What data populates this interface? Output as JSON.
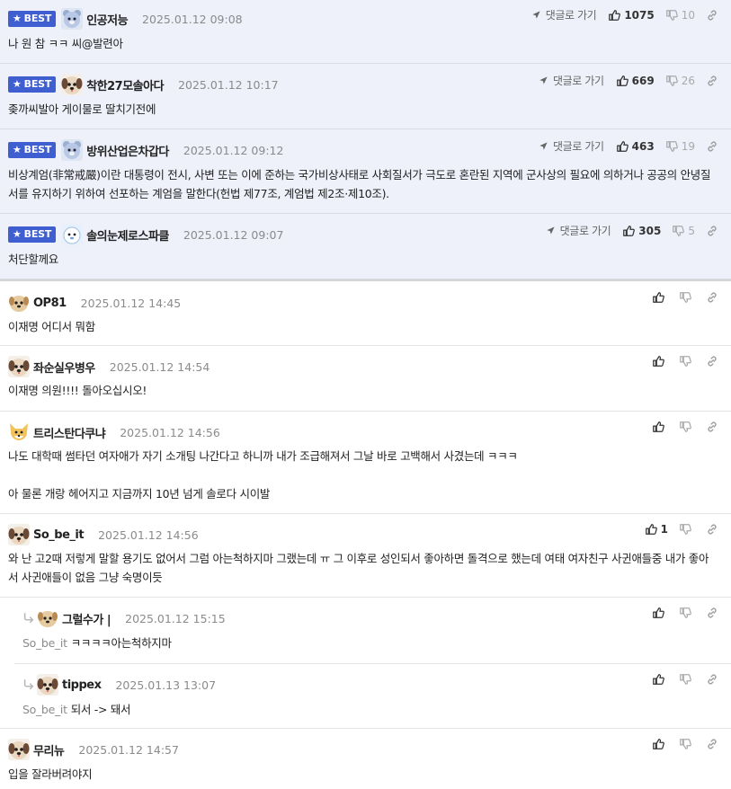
{
  "colors": {
    "best_bg": "#eef0fa",
    "badge": "#3f5fd0"
  },
  "best_badge": "BEST",
  "reply_label": "댓글로 가기",
  "best_comments": [
    {
      "nick": "인공저능",
      "time": "2025.01.12 09:08",
      "text": "나 원 참 ㅋㅋ 씨@발련아",
      "up": "1075",
      "down": "10"
    },
    {
      "nick": "착한27모솔아다",
      "time": "2025.01.12 10:17",
      "text": "좆까씨발아 게이물로 딸치기전에",
      "up": "669",
      "down": "26"
    },
    {
      "nick": "방위산업은차갑다",
      "time": "2025.01.12 09:12",
      "text": "비상계엄(非常戒嚴)이란 대통령이 전시, 사변 또는 이에 준하는 국가비상사태로 사회질서가 극도로 혼란된 지역에 군사상의 필요에 의하거나 공공의 안녕질서를 유지하기 위하여 선포하는 계엄을 말한다(헌법 제77조, 계엄법 제2조·제10조).",
      "up": "463",
      "down": "19"
    },
    {
      "nick": "솔의눈제로스파클",
      "time": "2025.01.12 09:07",
      "text": "처단할께요",
      "up": "305",
      "down": "5"
    }
  ],
  "comments": [
    {
      "nick": "OP81",
      "time": "2025.01.12 14:45",
      "text": "이재명 어디서 뭐함"
    },
    {
      "nick": "좌순실우병우",
      "time": "2025.01.12 14:54",
      "text": "이재명 의원!!!! 돌아오십시오!"
    },
    {
      "nick": "트리스탄다쿠냐",
      "time": "2025.01.12 14:56",
      "text1": "나도 대학때 썸타던 여자애가 자기 소개팅 나간다고 하니까 내가 조급해져서 그날 바로 고백해서 사겼는데 ㅋㅋㅋ",
      "text2": "아 물론 개랑 헤어지고 지금까지 10년 넘게 솔로다 시이발"
    },
    {
      "nick": "So_be_it",
      "time": "2025.01.12 14:56",
      "text": "와 난 고2때 저렇게 말할 용기도 없어서 그럼 아는척하지마 그랬는데 ㅠ 그 이후로 성인되서 좋아하면 돌격으로 했는데 여태 여자친구 사귄애들중 내가 좋아서 사귄애들이 없음 그냥 숙명이듯",
      "up": "1"
    },
    {
      "nick": "그럴수가 |",
      "time": "2025.01.12 15:15",
      "mention": "So_be_it",
      "text": "ㅋㅋㅋㅋ아는척하지마"
    },
    {
      "nick": "tippex",
      "time": "2025.01.13 13:07",
      "mention": "So_be_it",
      "text": "되서 -> 돼서"
    },
    {
      "nick": "무리뉴",
      "time": "2025.01.12 14:57",
      "text": "입을 잘라버려야지"
    }
  ]
}
